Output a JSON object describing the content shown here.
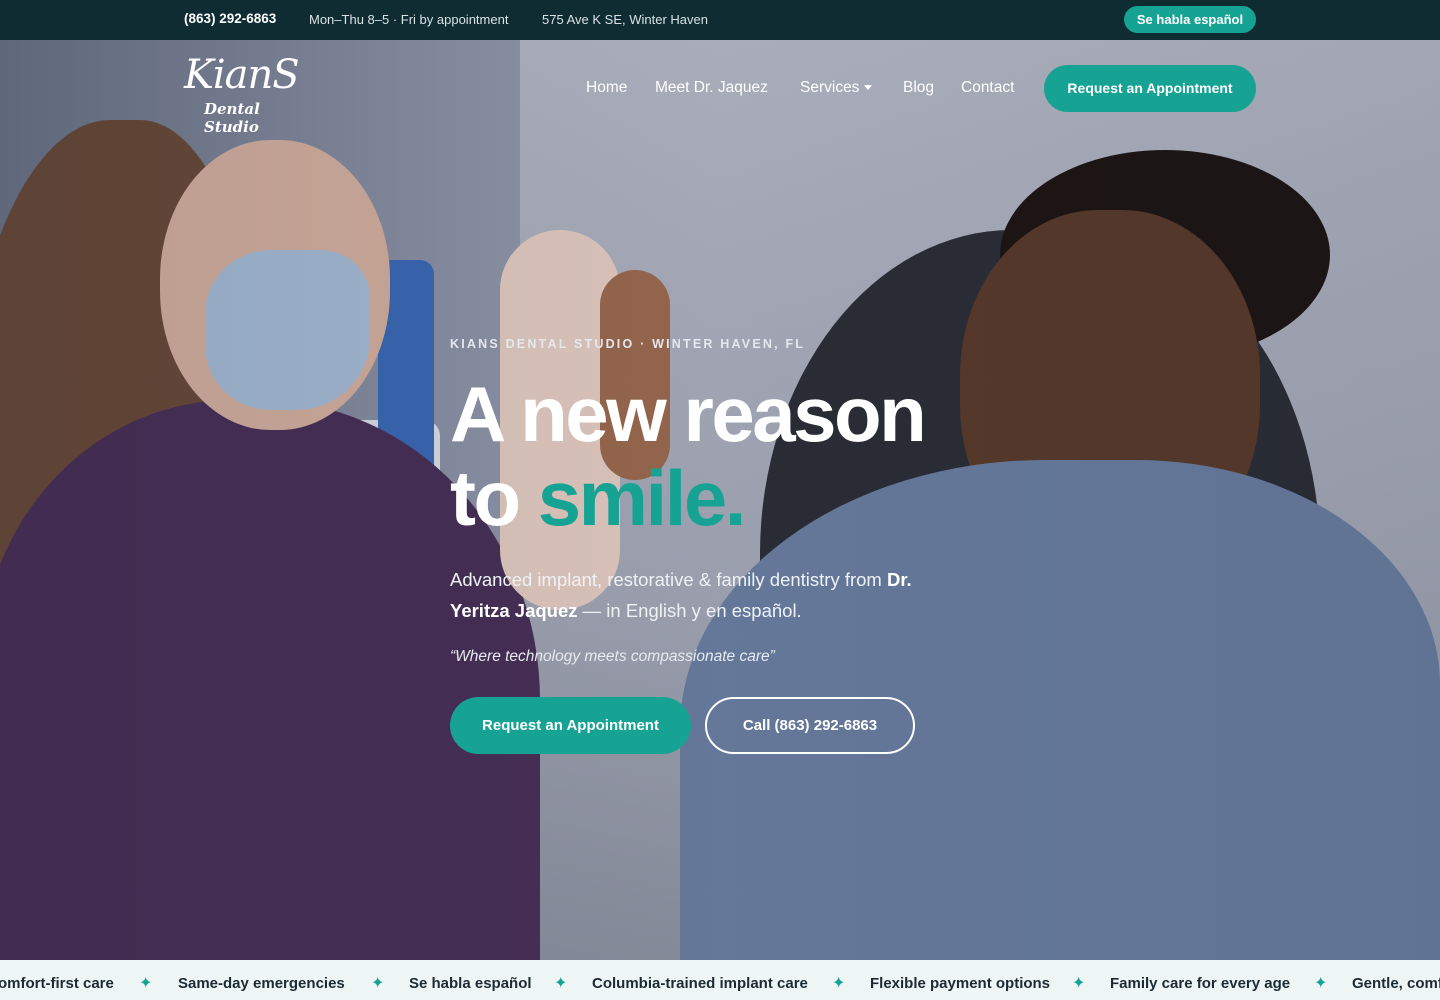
{
  "topbar": {
    "phone": "(863) 292-6863",
    "hours": "Mon–Thu 8–5 · Fri by appointment",
    "address": "575 Ave K SE, Winter Haven",
    "language_button": "Se habla español"
  },
  "brand": {
    "logo_main": "KianS",
    "logo_sub": "Dental Studio"
  },
  "nav": {
    "home": "Home",
    "meet": "Meet Dr. Jaquez",
    "services": "Services",
    "blog": "Blog",
    "contact": "Contact",
    "cta": "Request an Appointment"
  },
  "hero": {
    "eyebrow": "KIANS DENTAL STUDIO · WINTER HAVEN, FL",
    "headline_line1": "A new reason",
    "headline_to": "to ",
    "headline_accent": "smile.",
    "sub_prefix": "Advanced implant, restorative & family dentistry from ",
    "sub_name": "Dr. Yeritza Jaquez",
    "sub_suffix": " — in English y en español.",
    "quote": "“Where technology meets compassionate care”",
    "primary_button": "Request an Appointment",
    "secondary_button": "Call (863) 292-6863"
  },
  "strip": {
    "items": [
      "omfort-first care",
      "Same-day emergencies",
      "Se habla español",
      "Columbia-trained implant care",
      "Flexible payment options",
      "Family care for every age",
      "Gentle, comf"
    ],
    "separator": "✦"
  },
  "colors": {
    "accent": "#17a394",
    "dark": "#0f2c32",
    "strip_bg": "#eef6f5"
  }
}
